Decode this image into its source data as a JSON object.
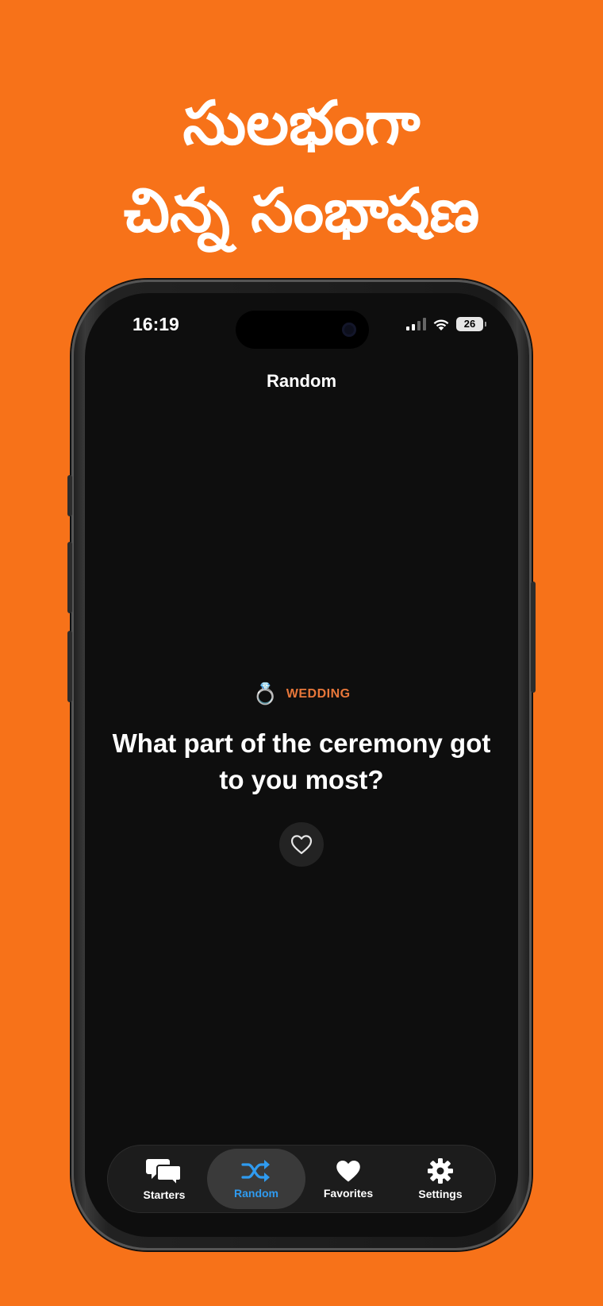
{
  "promo": {
    "headline_line1": "సులభంగా",
    "headline_line2": "చిన్న సంభాషణ"
  },
  "status_bar": {
    "time": "16:19",
    "battery": "26"
  },
  "nav": {
    "title": "Random"
  },
  "card": {
    "category_icon": "ring-emoji",
    "category_emoji": "💍",
    "category": "WEDDING",
    "question": "What part of the ceremony got to you most?"
  },
  "tabbar": {
    "tabs": [
      {
        "label": "Starters",
        "icon": "speech-bubbles-icon"
      },
      {
        "label": "Random",
        "icon": "shuffle-icon",
        "active": true
      },
      {
        "label": "Favorites",
        "icon": "heart-icon"
      },
      {
        "label": "Settings",
        "icon": "gear-icon"
      }
    ]
  },
  "colors": {
    "background": "#F77219",
    "accent": "#2F9BF0",
    "category": "#E8773A"
  }
}
